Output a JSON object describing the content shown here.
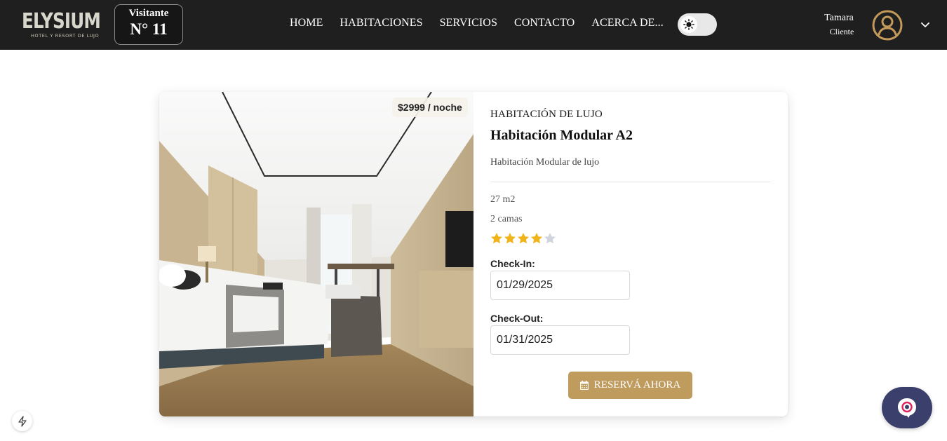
{
  "brand": {
    "name": "ELYSIUM",
    "tagline": "HOTEL Y RESORT DE LUJO"
  },
  "visitor": {
    "label": "Visitante",
    "number": "N° 11"
  },
  "nav": {
    "items": [
      {
        "label": "HOME"
      },
      {
        "label": "HABITACIONES"
      },
      {
        "label": "SERVICIOS"
      },
      {
        "label": "CONTACTO"
      },
      {
        "label": "ACERCA DE..."
      }
    ]
  },
  "user": {
    "name": "Tamara",
    "role": "Cliente"
  },
  "room": {
    "price": "$2999 / noche",
    "category": "HABITACIÓN DE LUJO",
    "title": "Habitación Modular A2",
    "description": "Habitación Modular de lujo",
    "size": "27 m2",
    "beds": "2 camas",
    "rating": 4,
    "rating_max": 5
  },
  "booking": {
    "checkin_label": "Check-In:",
    "checkin_value": "01/29/2025",
    "checkout_label": "Check-Out:",
    "checkout_value": "01/31/2025",
    "reserve_label": "RESERVÁ AHORA"
  },
  "colors": {
    "navbar": "#1f1f1f",
    "accent": "#bf9b5e",
    "star_on": "#f0b31a",
    "star_off": "#d0d4dc",
    "chat": "#3b3f6b"
  },
  "icons": {
    "theme": "sun-icon",
    "avatar": "user-circle-icon",
    "dropdown": "chevron-down-icon",
    "reserve": "calendar-icon",
    "dev": "bolt-icon",
    "chat": "chat-icon"
  }
}
